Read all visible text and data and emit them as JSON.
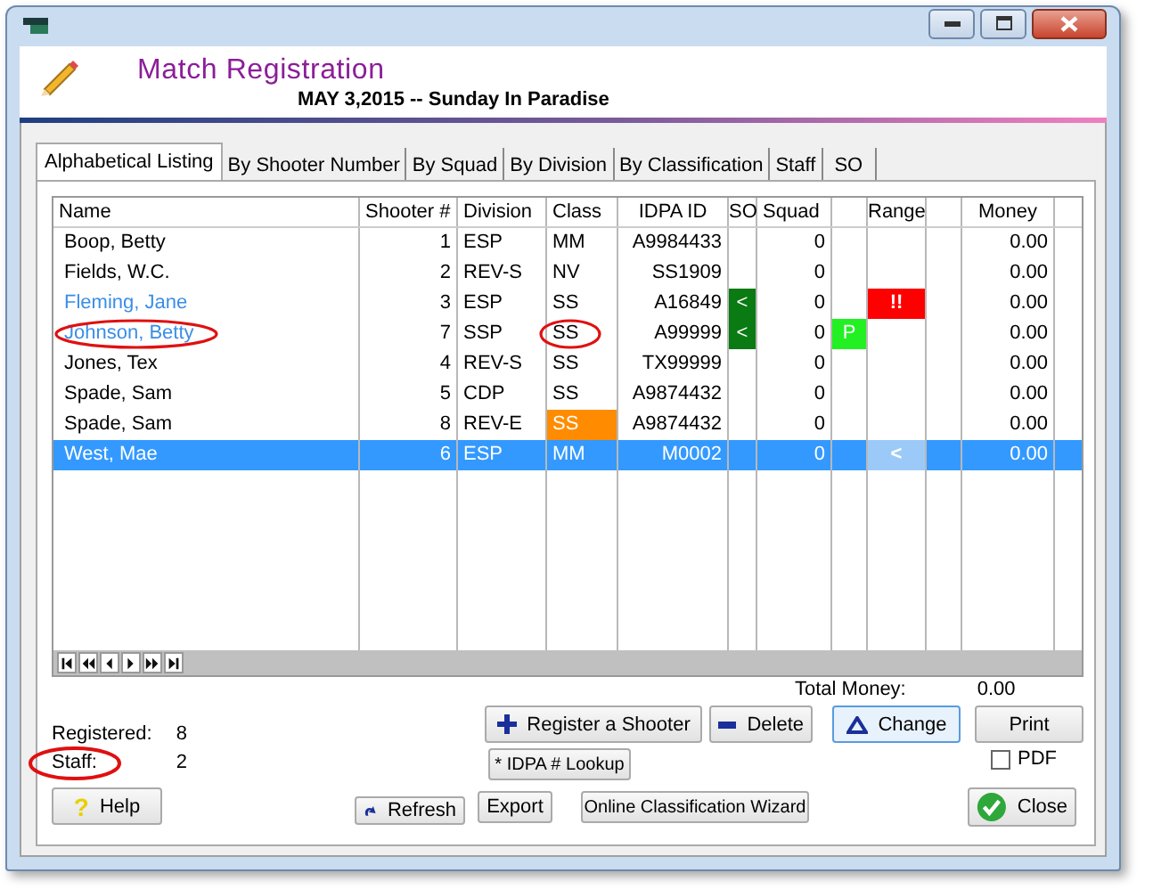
{
  "header": {
    "title": "Match Registration",
    "subtitle": "MAY  3,2015 -- Sunday In Paradise"
  },
  "tabs": [
    {
      "label": "Alphabetical Listing",
      "selected": true
    },
    {
      "label": "By Shooter Number",
      "selected": false
    },
    {
      "label": "By Squad",
      "selected": false
    },
    {
      "label": "By Division",
      "selected": false
    },
    {
      "label": "By Classification",
      "selected": false
    },
    {
      "label": "Staff",
      "selected": false
    },
    {
      "label": "SO",
      "selected": false
    }
  ],
  "table": {
    "columns": {
      "name": "Name",
      "shooter_no": "Shooter #",
      "division": "Division",
      "class": "Class",
      "idpa_id": "IDPA ID",
      "so": "SO",
      "squad": "Squad",
      "range": "Range",
      "money": "Money"
    },
    "rows": [
      {
        "name": "Boop, Betty",
        "marked": false,
        "shooter_no": "1",
        "division": "ESP",
        "class": "MM",
        "class_warning": false,
        "idpa_id": "A9984433",
        "squad": "0",
        "money": "0.00",
        "selected": false
      },
      {
        "name": "Fields, W.C.",
        "marked": false,
        "shooter_no": "2",
        "division": "REV-S",
        "class": "NV",
        "class_warning": false,
        "idpa_id": "SS1909",
        "squad": "0",
        "money": "0.00",
        "selected": false
      },
      {
        "name": "Fleming, Jane",
        "marked": true,
        "shooter_no": "3",
        "division": "ESP",
        "class": "SS",
        "class_warning": false,
        "idpa_id": "A16849",
        "so": "<",
        "squad": "0",
        "range": {
          "text": "!!",
          "color": "#ff0000"
        },
        "money": "0.00",
        "selected": false
      },
      {
        "name": "Johnson, Betty",
        "marked": true,
        "name_circled": true,
        "shooter_no": "7",
        "division": "SSP",
        "class": "SS",
        "class_warning": false,
        "class_circled": true,
        "idpa_id": "A99999",
        "so": "<",
        "squad": "0",
        "column_8": "P",
        "money": "0.00",
        "selected": false
      },
      {
        "name": "Jones, Tex",
        "marked": false,
        "shooter_no": "4",
        "division": "REV-S",
        "class": "SS",
        "class_warning": false,
        "idpa_id": "TX99999",
        "squad": "0",
        "money": "0.00",
        "selected": false
      },
      {
        "name": "Spade, Sam",
        "marked": false,
        "shooter_no": "5",
        "division": "CDP",
        "class": "SS",
        "class_warning": false,
        "idpa_id": "A9874432",
        "squad": "0",
        "money": "0.00",
        "selected": false
      },
      {
        "name": "Spade, Sam",
        "marked": false,
        "shooter_no": "8",
        "division": "REV-E",
        "class": "SS",
        "class_warning": true,
        "idpa_id": "A9874432",
        "squad": "0",
        "money": "0.00",
        "selected": false
      },
      {
        "name": "West, Mae",
        "marked": false,
        "shooter_no": "6",
        "division": "ESP",
        "class": "MM",
        "class_warning": false,
        "idpa_id": "M0002",
        "squad": "0",
        "range": {
          "text": "<",
          "color": "#9ccaf8"
        },
        "money": "0.00",
        "selected": true
      }
    ]
  },
  "totals": {
    "money_label": "Total Money:",
    "money": "0.00",
    "registered_label": "Registered:",
    "registered": "8",
    "staff_label": "Staff:",
    "staff": "2",
    "staff_circled": true
  },
  "buttons": {
    "register": "Register a Shooter",
    "delete": "Delete",
    "change": "Change",
    "print": "Print",
    "lookup": "* IDPA # Lookup",
    "help_icon": "?",
    "help": "Help",
    "refresh": "Refresh",
    "export": "Export",
    "wizard": "Online Classification Wizard",
    "close": "Close"
  },
  "pdf": {
    "label": "PDF",
    "checked": false
  }
}
